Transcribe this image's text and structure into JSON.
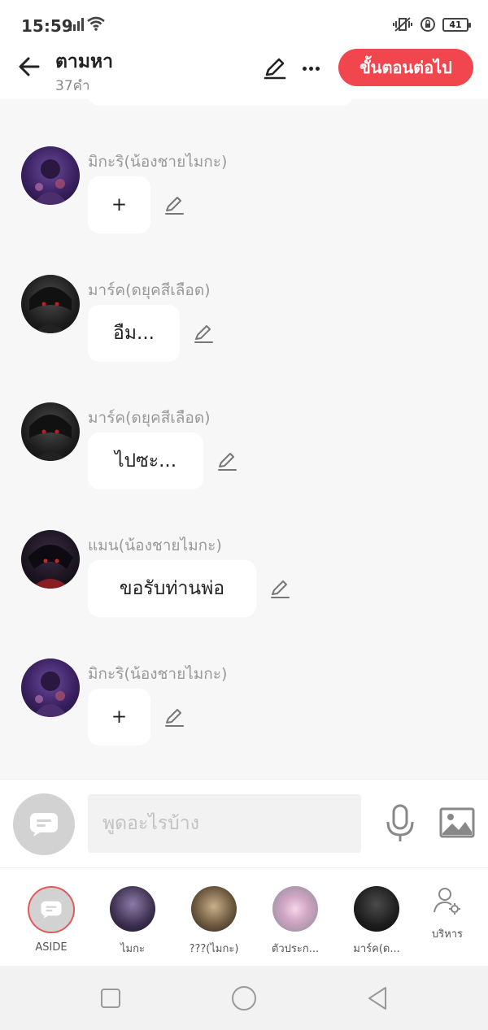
{
  "status": {
    "time": "15:59",
    "battery": "41"
  },
  "header": {
    "title": "ตามหา",
    "subtitle": "37คำ",
    "next_label": "ขั้นตอนต่อไป"
  },
  "messages": [
    {
      "sender": "มิกะริ(น้องชายไมกะ)",
      "text": "+"
    },
    {
      "sender": "มาร์ค(ดยุคสีเลือด)",
      "text": "อืม..."
    },
    {
      "sender": "มาร์ค(ดยุคสีเลือด)",
      "text": "ไปซะ..."
    },
    {
      "sender": "แมน(น้องชายไมกะ)",
      "text": "ขอรับท่านพ่อ"
    },
    {
      "sender": "มิกะริ(น้องชายไมกะ)",
      "text": "+"
    }
  ],
  "input": {
    "placeholder": "พูดอะไรบ้าง"
  },
  "characters": [
    {
      "label": "ASIDE"
    },
    {
      "label": "ไมกะ"
    },
    {
      "label": "???(ไมกะ)"
    },
    {
      "label": "ตัวประก..."
    },
    {
      "label": "มาร์ค(ด..."
    }
  ],
  "manage_label": "บริหาร",
  "icons": {
    "back": "arrow-left-icon",
    "edit": "pencil-icon",
    "more": "more-horizontal-icon",
    "aside": "chat-bubble-icon",
    "mic": "microphone-icon",
    "image": "image-icon",
    "manage": "user-gear-icon"
  },
  "colors": {
    "accent": "#f1464d"
  }
}
